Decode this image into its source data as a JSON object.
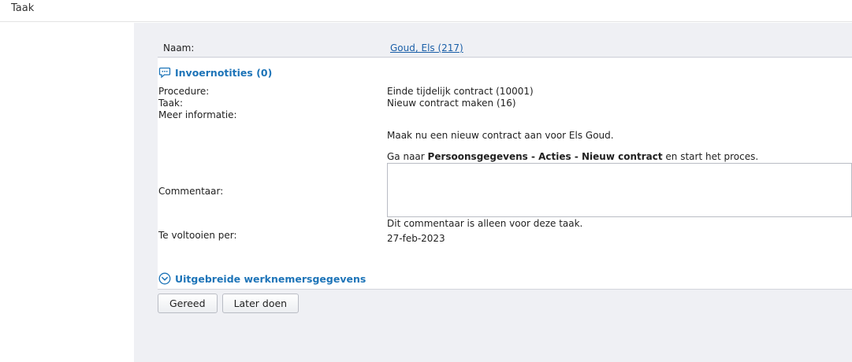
{
  "header": {
    "title": "Taak"
  },
  "employee": {
    "label": "Naam:",
    "value": "Goud, Els (217)"
  },
  "notes": {
    "title": "Invoernotities (0)",
    "icon": "speech-bubble-icon"
  },
  "fields": {
    "procedure": {
      "label": "Procedure:",
      "value": "Einde tijdelijk contract (10001)"
    },
    "task": {
      "label": "Taak:",
      "value": "Nieuw contract maken (16)"
    },
    "more_info": {
      "label": "Meer informatie:",
      "line1": "Maak nu een nieuw contract aan voor Els Goud.",
      "line2_prefix": "Ga naar ",
      "line2_bold": "Persoonsgegevens - Acties - Nieuw contract",
      "line2_suffix": " en start het proces."
    },
    "comment": {
      "label": "Commentaar:",
      "value": "",
      "hint": "Dit commentaar is alleen voor deze taak."
    },
    "due": {
      "label": "Te voltooien per:",
      "value": "27-feb-2023"
    }
  },
  "details": {
    "title": "Uitgebreide werknemersgegevens",
    "icon": "chevron-down-circle-icon"
  },
  "buttons": {
    "done": "Gereed",
    "later": "Later doen"
  },
  "colors": {
    "accent": "#1d74b8",
    "link": "#1a5fa8",
    "background": "#eff0f4"
  }
}
